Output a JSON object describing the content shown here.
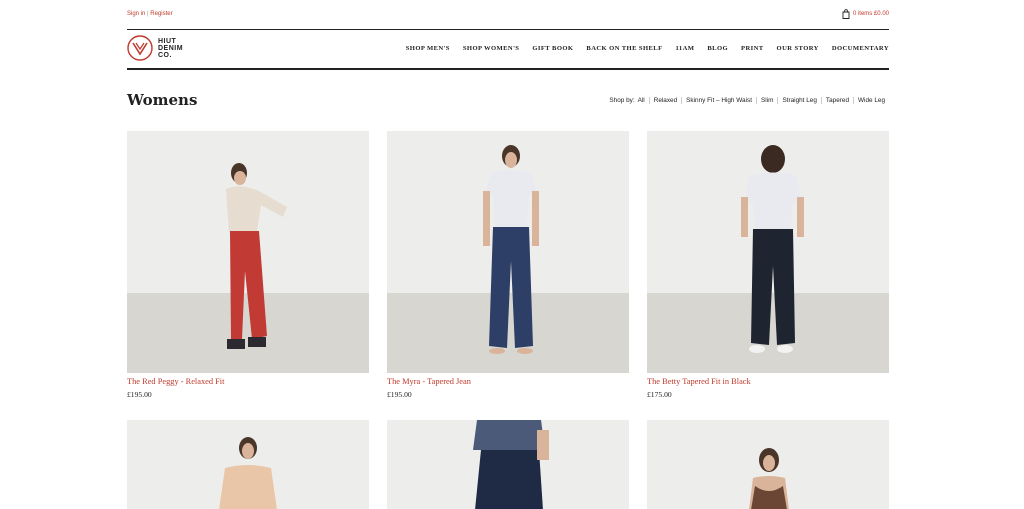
{
  "auth": {
    "sign_in": "Sign in",
    "separator": "|",
    "register": "Register"
  },
  "cart": {
    "label": "0 items £0.00",
    "icon": "bag-icon"
  },
  "logo": {
    "line1": "HIUT",
    "line2": "DENIM",
    "line3": "CO.",
    "icon": "hiut-logo-mark",
    "color": "#c0392b"
  },
  "nav": [
    {
      "label": "SHOP MEN'S"
    },
    {
      "label": "SHOP WOMEN'S"
    },
    {
      "label": "GIFT BOOK"
    },
    {
      "label": "BACK ON THE SHELF"
    },
    {
      "label": "11AM"
    },
    {
      "label": "BLOG"
    },
    {
      "label": "PRINT"
    },
    {
      "label": "OUR STORY"
    },
    {
      "label": "DOCUMENTARY"
    }
  ],
  "page": {
    "title": "Womens"
  },
  "filters": {
    "label": "Shop by:",
    "options": [
      "All",
      "Relaxed",
      "Skinny Fit – High Waist",
      "Slim",
      "Straight Leg",
      "Tapered",
      "Wide Leg"
    ]
  },
  "products": [
    {
      "name": "The Red Peggy - Relaxed Fit",
      "price": "£195.00",
      "jean_color": "#c23a34",
      "top_color": "#e6ddd0"
    },
    {
      "name": "The Myra - Tapered Jean",
      "price": "£195.00",
      "jean_color": "#2d3f66",
      "top_color": "#e8eaf0"
    },
    {
      "name": "The Betty Tapered Fit in Black",
      "price": "£175.00",
      "jean_color": "#1f2530",
      "top_color": "#e8eaf0"
    }
  ],
  "products_row2": [
    {
      "top_color": "#e9c6a8"
    },
    {
      "top_color": "#4a5a78"
    },
    {
      "top_color": "#6b4634"
    }
  ],
  "colors": {
    "accent": "#c0392b",
    "text": "#222222"
  }
}
